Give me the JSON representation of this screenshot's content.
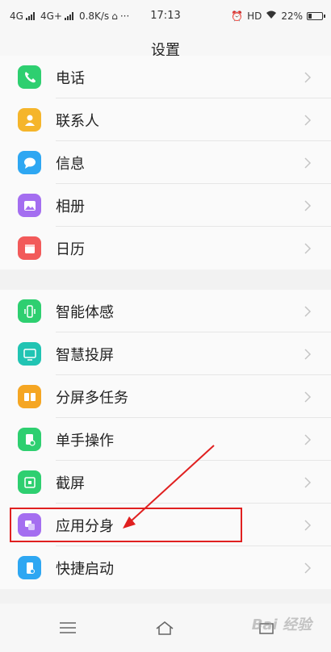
{
  "status_bar": {
    "network1": "4G",
    "network2": "4G+",
    "speed": "0.8K/s",
    "time": "17:13",
    "hd": "HD",
    "battery": "22%",
    "battery_level": 0.22
  },
  "header": {
    "title": "设置"
  },
  "group1": [
    {
      "label": "电话",
      "icon": "phone-icon",
      "color": "#2ecf70"
    },
    {
      "label": "联系人",
      "icon": "contact-icon",
      "color": "#f5b52b"
    },
    {
      "label": "信息",
      "icon": "message-icon",
      "color": "#2ea7f2"
    },
    {
      "label": "相册",
      "icon": "gallery-icon",
      "color": "#a46ef0"
    },
    {
      "label": "日历",
      "icon": "calendar-icon",
      "color": "#f25a5a"
    }
  ],
  "group2": [
    {
      "label": "智能体感",
      "icon": "motion-sense-icon",
      "color": "#2ecf70"
    },
    {
      "label": "智慧投屏",
      "icon": "screen-cast-icon",
      "color": "#21c4b3"
    },
    {
      "label": "分屏多任务",
      "icon": "split-screen-icon",
      "color": "#f5a623"
    },
    {
      "label": "单手操作",
      "icon": "one-hand-icon",
      "color": "#2ecf70"
    },
    {
      "label": "截屏",
      "icon": "screenshot-icon",
      "color": "#2ecf70"
    },
    {
      "label": "应用分身",
      "icon": "app-clone-icon",
      "color": "#a46ef0"
    },
    {
      "label": "快捷启动",
      "icon": "quick-launch-icon",
      "color": "#2ea7f2"
    }
  ],
  "watermark": "Bai 经验"
}
